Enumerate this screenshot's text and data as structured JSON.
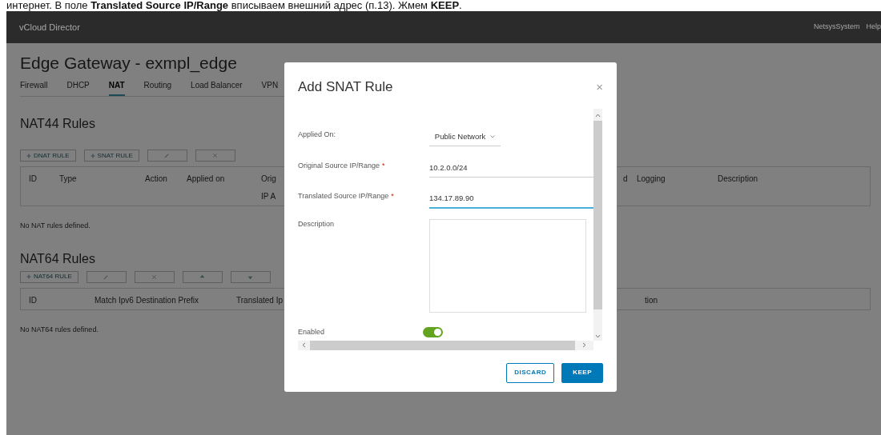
{
  "caption": "интернет. В поле **Translated Source IP/Range** вписываем внешний адрес (п.13). Жмем **KEEP**.",
  "header": {
    "brand": "vCloud Director",
    "user": "NetsysSystem",
    "help": "Help"
  },
  "page": {
    "title": "Edge Gateway - exmpl_edge",
    "tabs": [
      {
        "label": "Firewall",
        "selected": false
      },
      {
        "label": "DHCP",
        "selected": false
      },
      {
        "label": "NAT",
        "selected": true
      },
      {
        "label": "Routing",
        "selected": false
      },
      {
        "label": "Load Balancer",
        "selected": false
      },
      {
        "label": "VPN",
        "selected": false
      }
    ],
    "nat44": {
      "heading": "NAT44 Rules",
      "buttons": [
        {
          "kind": "add",
          "label": "DNAT RULE"
        },
        {
          "kind": "add",
          "label": "SNAT RULE"
        },
        {
          "kind": "edit"
        },
        {
          "kind": "delete"
        }
      ],
      "columns": [
        {
          "label": "ID"
        },
        {
          "label": "Type"
        },
        {
          "label": "Action"
        },
        {
          "label": "Applied on"
        },
        {
          "label": "Orig",
          "second_line": "IP A"
        },
        {
          "label": "d"
        },
        {
          "label": "Logging"
        },
        {
          "label": "Description"
        }
      ],
      "empty": "No NAT rules defined."
    },
    "nat64": {
      "heading": "NAT64 Rules",
      "buttons": [
        {
          "kind": "add",
          "label": "NAT64 RULE"
        },
        {
          "kind": "edit"
        },
        {
          "kind": "delete"
        },
        {
          "kind": "up"
        },
        {
          "kind": "down"
        }
      ],
      "columns": [
        {
          "label": "ID"
        },
        {
          "label": "Match Ipv6 Destination Prefix"
        },
        {
          "label": "Translated Ip"
        },
        {
          "label": "tion"
        }
      ],
      "empty": "No NAT64 rules defined."
    }
  },
  "dialog": {
    "title": "Add SNAT Rule",
    "close": "×",
    "fields": [
      {
        "kind": "select",
        "label": "Applied On:",
        "value": "Public Network"
      },
      {
        "kind": "text",
        "label": "Original Source IP/Range",
        "required_mark": "*",
        "value": "10.2.0.0/24",
        "focused": false
      },
      {
        "kind": "text",
        "label": "Translated Source IP/Range",
        "required_mark": "*",
        "value": "134.17.89.90",
        "focused": true
      },
      {
        "kind": "textarea",
        "label": "Description"
      },
      {
        "kind": "toggle",
        "label": "Enabled",
        "on": true
      }
    ],
    "buttons": [
      {
        "kind": "secondary",
        "label": "DISCARD"
      },
      {
        "kind": "primary",
        "label": "KEEP"
      }
    ]
  }
}
